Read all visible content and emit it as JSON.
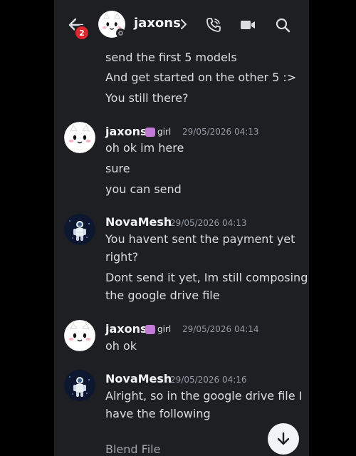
{
  "header": {
    "notification_count": "2",
    "channel_name": "jaxons"
  },
  "messages": [
    {
      "lines": [
        "send the first 5 models",
        "And get started on the other 5 :>",
        "You still there?"
      ]
    },
    {
      "author": "jaxons",
      "tag": "girl",
      "timestamp": "29/05/2026 04:13",
      "lines": [
        "oh ok im here",
        "sure",
        "you can send"
      ]
    },
    {
      "author": "NovaMesh",
      "timestamp": "29/05/2026 04:13",
      "lines": [
        "You havent sent the payment yet",
        "right?",
        "Dont send it yet, Im still composing",
        "the google drive file"
      ]
    },
    {
      "author": "jaxons",
      "tag": "girl",
      "timestamp": "29/05/2026 04:14",
      "lines": [
        "oh ok"
      ]
    },
    {
      "author": "NovaMesh",
      "timestamp": "29/05/2026 04:16",
      "lines": [
        "Alright, so in the google drive file I",
        "have the following",
        "Blend File"
      ]
    }
  ],
  "colors": {
    "background": "#1e1f22",
    "text": "#dbdee1",
    "timestamp": "#949ba4",
    "badge": "#e0272e",
    "tag_icon": "#c37ad6"
  },
  "icons": [
    "back-arrow-icon",
    "phone-call-icon",
    "video-camera-icon",
    "search-icon",
    "chevron-right-icon",
    "arrow-down-icon"
  ]
}
